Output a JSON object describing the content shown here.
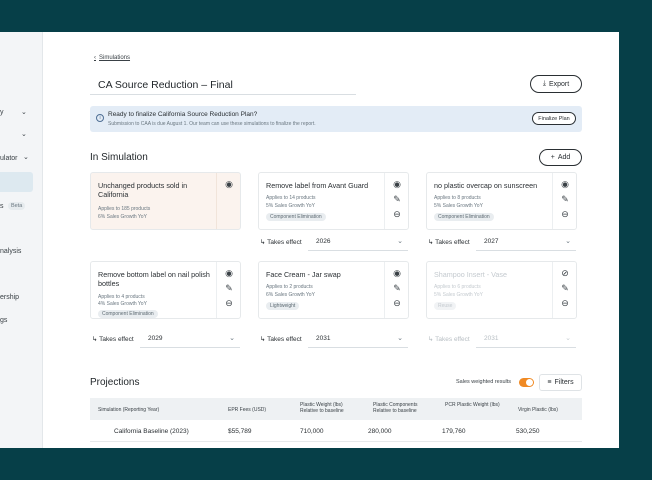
{
  "sidebar": {
    "items": [
      {
        "label": "y"
      },
      {
        "label": ""
      },
      {
        "label": "ulator"
      },
      {
        "label": ""
      },
      {
        "label": "s"
      },
      {
        "label": "nalysis"
      },
      {
        "label": "ership"
      },
      {
        "label": "gs"
      }
    ],
    "badge": "Beta"
  },
  "breadcrumb": {
    "label": "Simulations"
  },
  "page": {
    "title": "CA Source Reduction – Final",
    "export_label": "Export"
  },
  "banner": {
    "title": "Ready to finalize California Source Reduction Plan?",
    "subtitle": "Submission to CAA is due August 1. Our team can use these simulations to finalize the report.",
    "button_label": "Finalize Plan"
  },
  "in_simulation": {
    "title": "In Simulation",
    "add_label": "Add",
    "cards": [
      {
        "title": "Unchanged products sold in California",
        "sub1": "Applies to 185 products",
        "sub2": "6% Sales Growth YoY",
        "tag": "",
        "effect_label": "",
        "effect_year": ""
      },
      {
        "title": "Remove label from Avant Guard",
        "sub1": "Applies to 14 products",
        "sub2": "5% Sales Growth YoY",
        "tag": "Component Elimination",
        "effect_label": "Takes effect",
        "effect_year": "2026"
      },
      {
        "title": "no plastic overcap on sunscreen",
        "sub1": "Applies to 8 products",
        "sub2": "5% Sales Growth YoY",
        "tag": "Component Elimination",
        "effect_label": "Takes effect",
        "effect_year": "2027"
      },
      {
        "title": "Remove bottom label on nail polish bottles",
        "sub1": "Applies to 4 products",
        "sub2": "4% Sales Growth YoY",
        "tag": "Component Elimination",
        "effect_label": "Takes effect",
        "effect_year": "2029"
      },
      {
        "title": "Face Cream - Jar swap",
        "sub1": "Applies to 2 products",
        "sub2": "6% Sales Growth YoY",
        "tag": "Lightweight",
        "effect_label": "Takes effect",
        "effect_year": "2031"
      },
      {
        "title": "Shampoo Insert - Vase",
        "sub1": "Applies to 6 products",
        "sub2": "5% Sales Growth YoY",
        "tag": "Reuse",
        "effect_label": "Takes effect",
        "effect_year": "2031"
      }
    ]
  },
  "projections": {
    "title": "Projections",
    "toggle_label": "Sales weighted results",
    "filters_label": "Filters",
    "columns": [
      "Simulation (Reporting Year)",
      "EPR Fees (USD)",
      "Plastic Weight (lbs) Relative to baseline",
      "Plastic Components Relative to baseline",
      "PCR Plastic Weight (lbs)",
      "Virgin Plastic (lbs)"
    ],
    "rows": [
      [
        "California Baseline (2023)",
        "$55,789",
        "710,000",
        "280,000",
        "179,760",
        "530,250"
      ]
    ]
  },
  "colors": {
    "frame": "#063f48",
    "banner": "#e3ecf6",
    "toggle": "#f08a24",
    "highlight_card": "#fbf3ee"
  },
  "icons": [
    "chevron-left-icon",
    "download-icon",
    "info-icon",
    "eye-icon",
    "pencil-icon",
    "minus-circle-icon",
    "eye-off-icon",
    "plus-icon",
    "filter-icon",
    "chevron-down-icon",
    "corner-arrow-icon"
  ]
}
